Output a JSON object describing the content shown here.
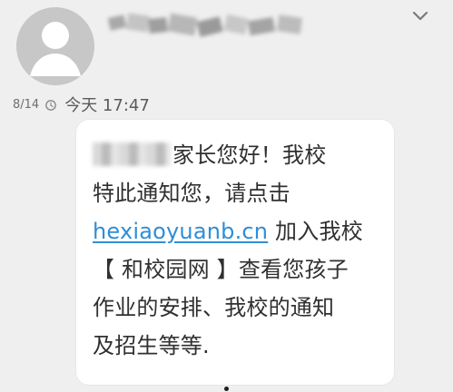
{
  "message": {
    "date_short": "8/14",
    "datetime": "今天 17:47",
    "line1": "家长您好！我校",
    "line2": "特此通知您，请点击",
    "link": "hexiaoyuanb.cn",
    "line3_after_link": " 加入我校",
    "line4": "【 和校园网 】查看您孩子",
    "line5": "作业的安排、我校的通知",
    "line6": "及招生等等."
  },
  "icons": {
    "avatar": "avatar-icon",
    "chevron": "chevron-down-icon",
    "clock": "clock-icon"
  },
  "colors": {
    "background": "#efefef",
    "bubble": "#ffffff",
    "link": "#2f8ed6",
    "text": "#303030",
    "secondary": "#6f6f6f"
  }
}
